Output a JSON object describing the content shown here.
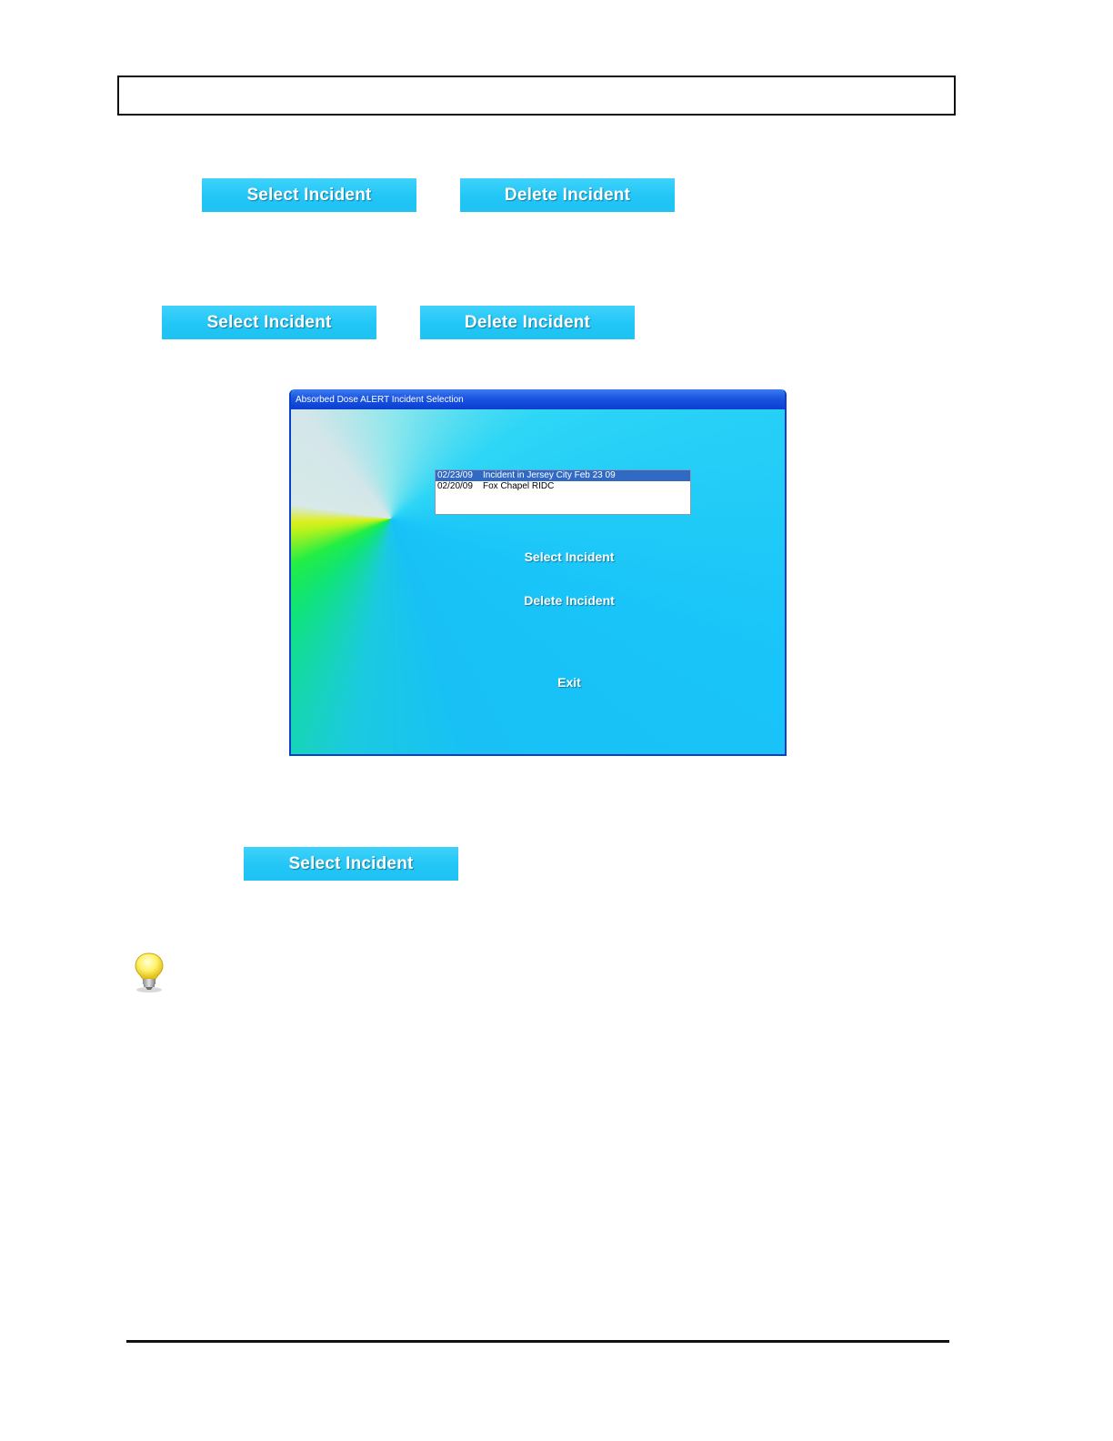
{
  "buttons": {
    "select_label": "Select Incident",
    "delete_label": "Delete Incident"
  },
  "window": {
    "title": "Absorbed Dose ALERT Incident Selection",
    "incidents": [
      {
        "date": "02/23/09",
        "name": "Incident in Jersey City Feb 23 09",
        "selected": true
      },
      {
        "date": "02/20/09",
        "name": "Fox Chapel RIDC",
        "selected": false
      }
    ],
    "select_label": "Select Incident",
    "delete_label": "Delete Incident",
    "exit_label": "Exit"
  },
  "icons": {
    "tip": "lightbulb-icon"
  },
  "colors": {
    "button_cyan": "#22c6f6",
    "titlebar_blue": "#1a55e0",
    "selection_blue": "#316ac5"
  }
}
